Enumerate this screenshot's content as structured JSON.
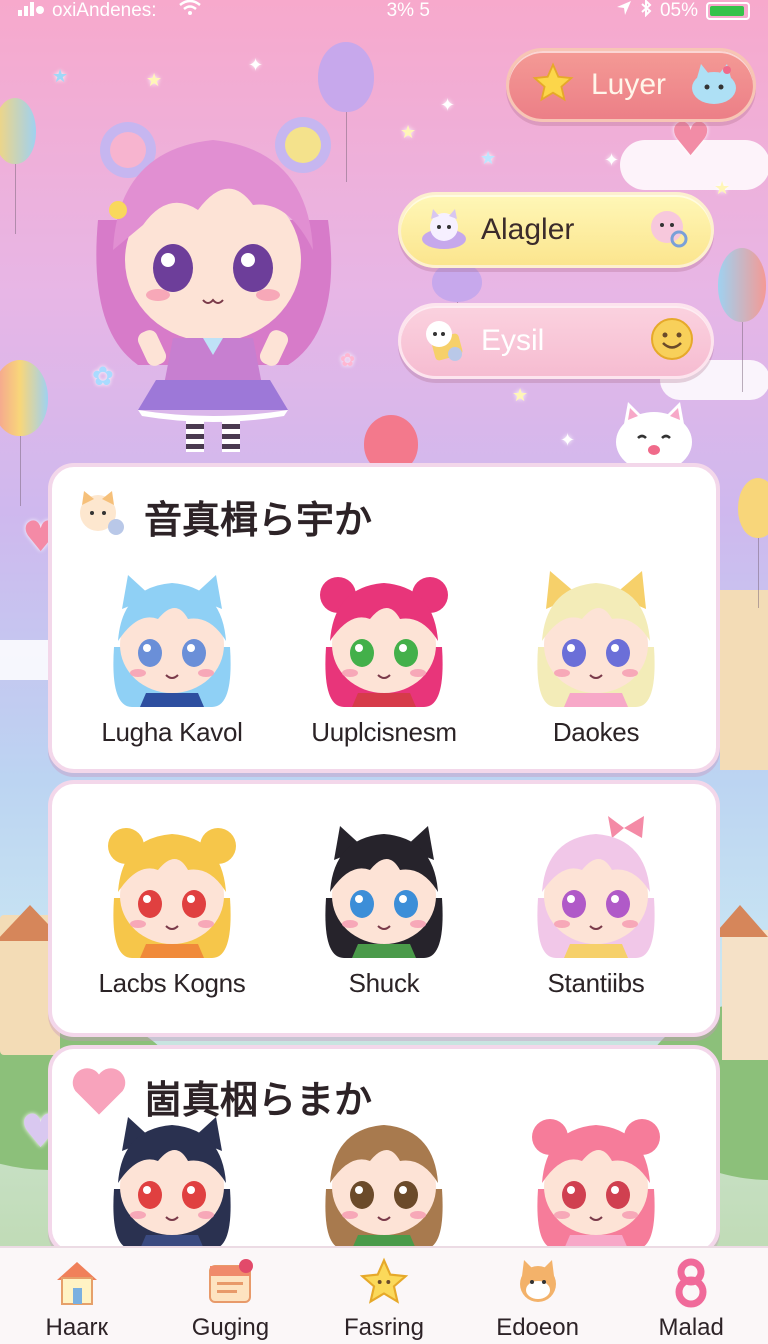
{
  "status_bar": {
    "carrier": "oxiAndenes:",
    "center": "3% 5",
    "battery_pct": "05%",
    "battery_level": 0.95,
    "signal_icon": "signal-bars-icon",
    "wifi_icon": "wifi-icon",
    "location_icon": "location-arrow-icon",
    "bluetooth_icon": "bluetooth-icon"
  },
  "menu": {
    "layer_label": "Luyer",
    "alagler_label": "Alagler",
    "eysil_label": "Eysil"
  },
  "sections": [
    {
      "title": "音真楫ら宇か",
      "characters": [
        {
          "name": "Lugha Kavol",
          "hair": "#8fd0f5",
          "eyes": "#6a8fd8",
          "outfit": "#2e4fa0",
          "ears": "cat"
        },
        {
          "name": "Uuplcisnesm",
          "hair": "#e8357a",
          "eyes": "#43b04a",
          "outfit": "#d63b4a",
          "ears": "buns"
        },
        {
          "name": "Daokes",
          "hair": "#f3ecb8",
          "eyes": "#6b6fd8",
          "outfit": "#f7a8c8",
          "ears": "fox"
        }
      ]
    },
    {
      "title": "",
      "characters": [
        {
          "name": "Lacbs Kogns",
          "hair": "#f6c64a",
          "eyes": "#e04040",
          "outfit": "#f08a3a",
          "ears": "buns"
        },
        {
          "name": "Shuck",
          "hair": "#26232b",
          "eyes": "#3c8ed8",
          "outfit": "#4a9a4a",
          "ears": "cat"
        },
        {
          "name": "Stantiibs",
          "hair": "#f1c7e8",
          "eyes": "#b05ac8",
          "outfit": "#f6d06a",
          "ears": "bow"
        }
      ]
    },
    {
      "title": "崮真栶らまか",
      "characters": [
        {
          "name": "",
          "hair": "#2a3150",
          "eyes": "#e04040",
          "outfit": "#3a4a80",
          "ears": "cat"
        },
        {
          "name": "",
          "hair": "#a87a4e",
          "eyes": "#6b4a2a",
          "outfit": "#4a9a4a",
          "ears": "none"
        },
        {
          "name": "",
          "hair": "#f67c9a",
          "eyes": "#d04050",
          "outfit": "#f7a8c8",
          "ears": "buns"
        }
      ]
    }
  ],
  "bottom_nav": [
    {
      "label": "Haarк",
      "icon": "house-icon"
    },
    {
      "label": "Guging",
      "icon": "calendar-icon"
    },
    {
      "label": "Fasring",
      "icon": "star-cookie-icon"
    },
    {
      "label": "Edoeon",
      "icon": "shiba-dog-icon"
    },
    {
      "label": "Malad",
      "icon": "number-eight-icon"
    }
  ],
  "colors": {
    "accent_pink": "#ec7f87",
    "accent_yellow": "#fbe58e",
    "card_border": "#f3d7ea",
    "battery_green": "#35c24a"
  }
}
